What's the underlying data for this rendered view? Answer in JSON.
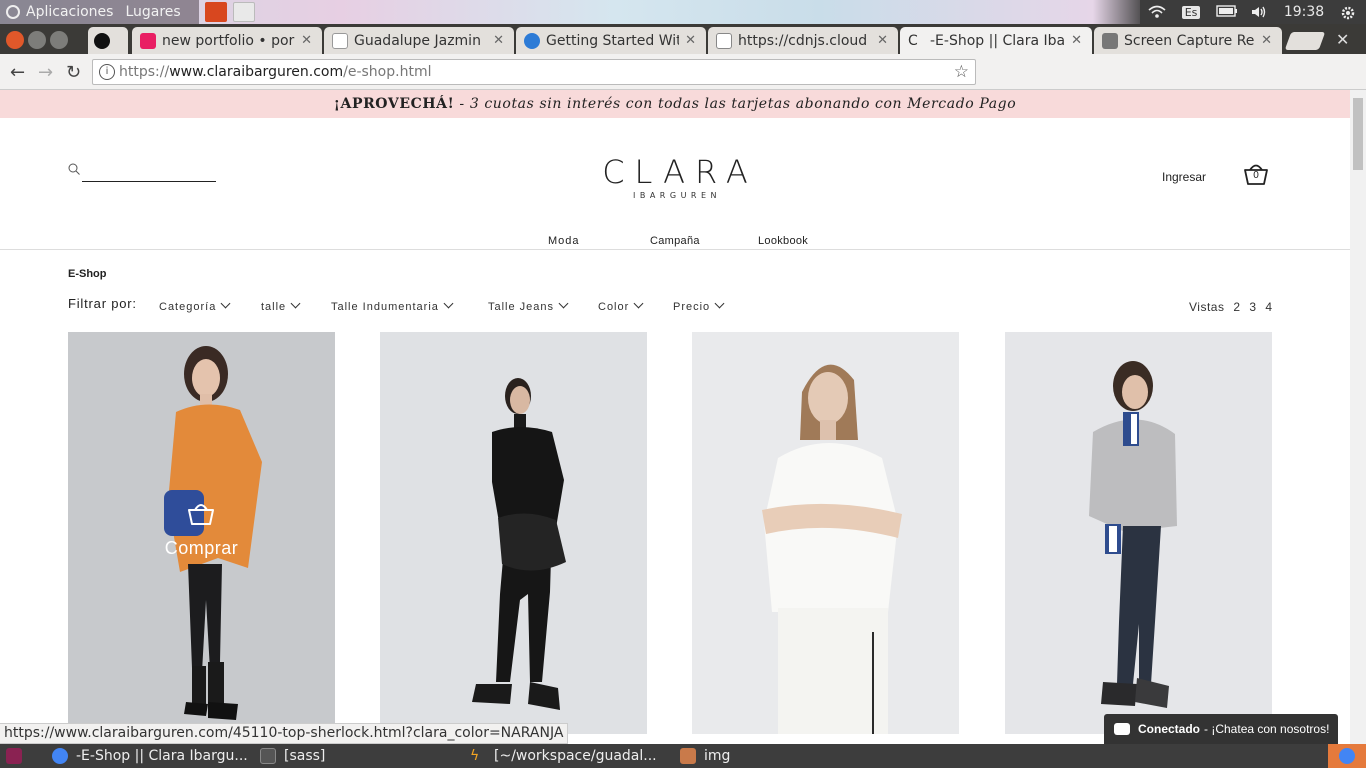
{
  "os": {
    "menu_apps": "Aplicaciones",
    "menu_places": "Lugares",
    "keyboard_layout": "Es",
    "clock": "19:38"
  },
  "tabs": [
    {
      "label": "new portfolio • por",
      "favicon_color": "#e91e63",
      "favicon": "M"
    },
    {
      "label": "Guadalupe Jazmin",
      "favicon_color": "#ffffff",
      "favicon": "panda"
    },
    {
      "label": "Getting Started Wit",
      "favicon_color": "#2d7bd6",
      "favicon": "S"
    },
    {
      "label": "https://cdnjs.cloud",
      "favicon_color": "#ffffff",
      "favicon": "C"
    },
    {
      "label": "-E-Shop || Clara Ibar",
      "favicon_color": "#f2f1f0",
      "favicon": "C"
    },
    {
      "label": "Screen Capture Res",
      "favicon_color": "#777777",
      "favicon": "camera"
    }
  ],
  "address": {
    "scheme": "https://",
    "host": "www.claraibarguren.com",
    "path": "/e-shop.html"
  },
  "promo": {
    "bold": "¡APROVECHÁ!",
    "sep": " - ",
    "italic": "3 cuotas sin interés con todas las tarjetas abonando con Mercado Pago"
  },
  "header": {
    "logo_main": "CLARA",
    "logo_sub": "IBARGUREN",
    "login": "Ingresar",
    "cart_count": "0"
  },
  "nav": [
    "Moda",
    "Campaña",
    "Lookbook"
  ],
  "breadcrumb": "E-Shop",
  "filters": {
    "label": "Filtrar por:",
    "items": [
      "Categoría",
      "talle",
      "Talle Indumentaria",
      "Talle Jeans",
      "Color",
      "Precio"
    ]
  },
  "views": {
    "label": "Vistas",
    "options": [
      "2",
      "3",
      "4"
    ]
  },
  "products": [
    {
      "name": "top-sherlock naranja",
      "color": "#e38a3a",
      "hover_label": "Comprar"
    },
    {
      "name": "black top look",
      "color": "#1d1d1d"
    },
    {
      "name": "white top look",
      "color": "#f6f6f4"
    },
    {
      "name": "grey sweater look",
      "color": "#b9b9bb"
    }
  ],
  "status_url": "https://www.claraibarguren.com/45110-top-sherlock.html?clara_color=NARANJA",
  "chat": {
    "status": "Conectado",
    "message": "- ¡Chatea con nosotros!"
  },
  "taskbar": [
    {
      "label": "-E-Shop || Clara Ibargu..."
    },
    {
      "label": "[sass]"
    },
    {
      "label": "[~/workspace/guadal..."
    },
    {
      "label": "img"
    }
  ]
}
